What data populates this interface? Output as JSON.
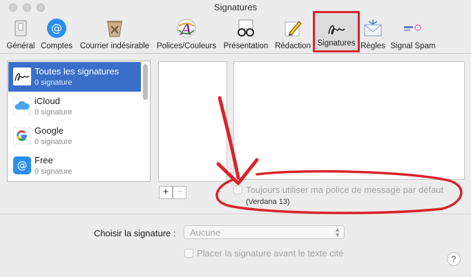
{
  "window": {
    "title": "Signatures"
  },
  "toolbar": {
    "items": [
      {
        "label": "Général",
        "icon": "switch-icon"
      },
      {
        "label": "Comptes",
        "icon": "at-icon"
      },
      {
        "label": "Courrier indésirable",
        "icon": "junk-bin-icon"
      },
      {
        "label": "Polices/Couleurs",
        "icon": "font-color-icon"
      },
      {
        "label": "Présentation",
        "icon": "glasses-icon"
      },
      {
        "label": "Rédaction",
        "icon": "pencil-icon"
      },
      {
        "label": "Signatures",
        "icon": "signature-icon",
        "selected": true
      },
      {
        "label": "Règles",
        "icon": "rules-envelope-icon"
      },
      {
        "label": "Signal Spam",
        "icon": "signal-spam-logo-icon"
      }
    ]
  },
  "accounts": [
    {
      "name": "Toutes les signatures",
      "count": "0 signature",
      "icon": "signature-icon",
      "selected": true
    },
    {
      "name": "iCloud",
      "count": "0 signature",
      "icon": "cloud-icon"
    },
    {
      "name": "Google",
      "count": "0 signature",
      "icon": "google-icon"
    },
    {
      "name": "Free",
      "count": "0 signature",
      "icon": "at-icon"
    }
  ],
  "buttons": {
    "add": "+",
    "remove": "−",
    "help": "?"
  },
  "options": {
    "default_font_label": "Toujours utiliser ma police de message par défaut",
    "default_font_info": "(Verdana 13)",
    "choose_label": "Choisir la signature :",
    "choose_value": "Aucune",
    "place_above_label": "Placer la signature avant le texte cité"
  },
  "colors": {
    "selection": "#3a6fc9",
    "annotation": "#d8232a"
  }
}
